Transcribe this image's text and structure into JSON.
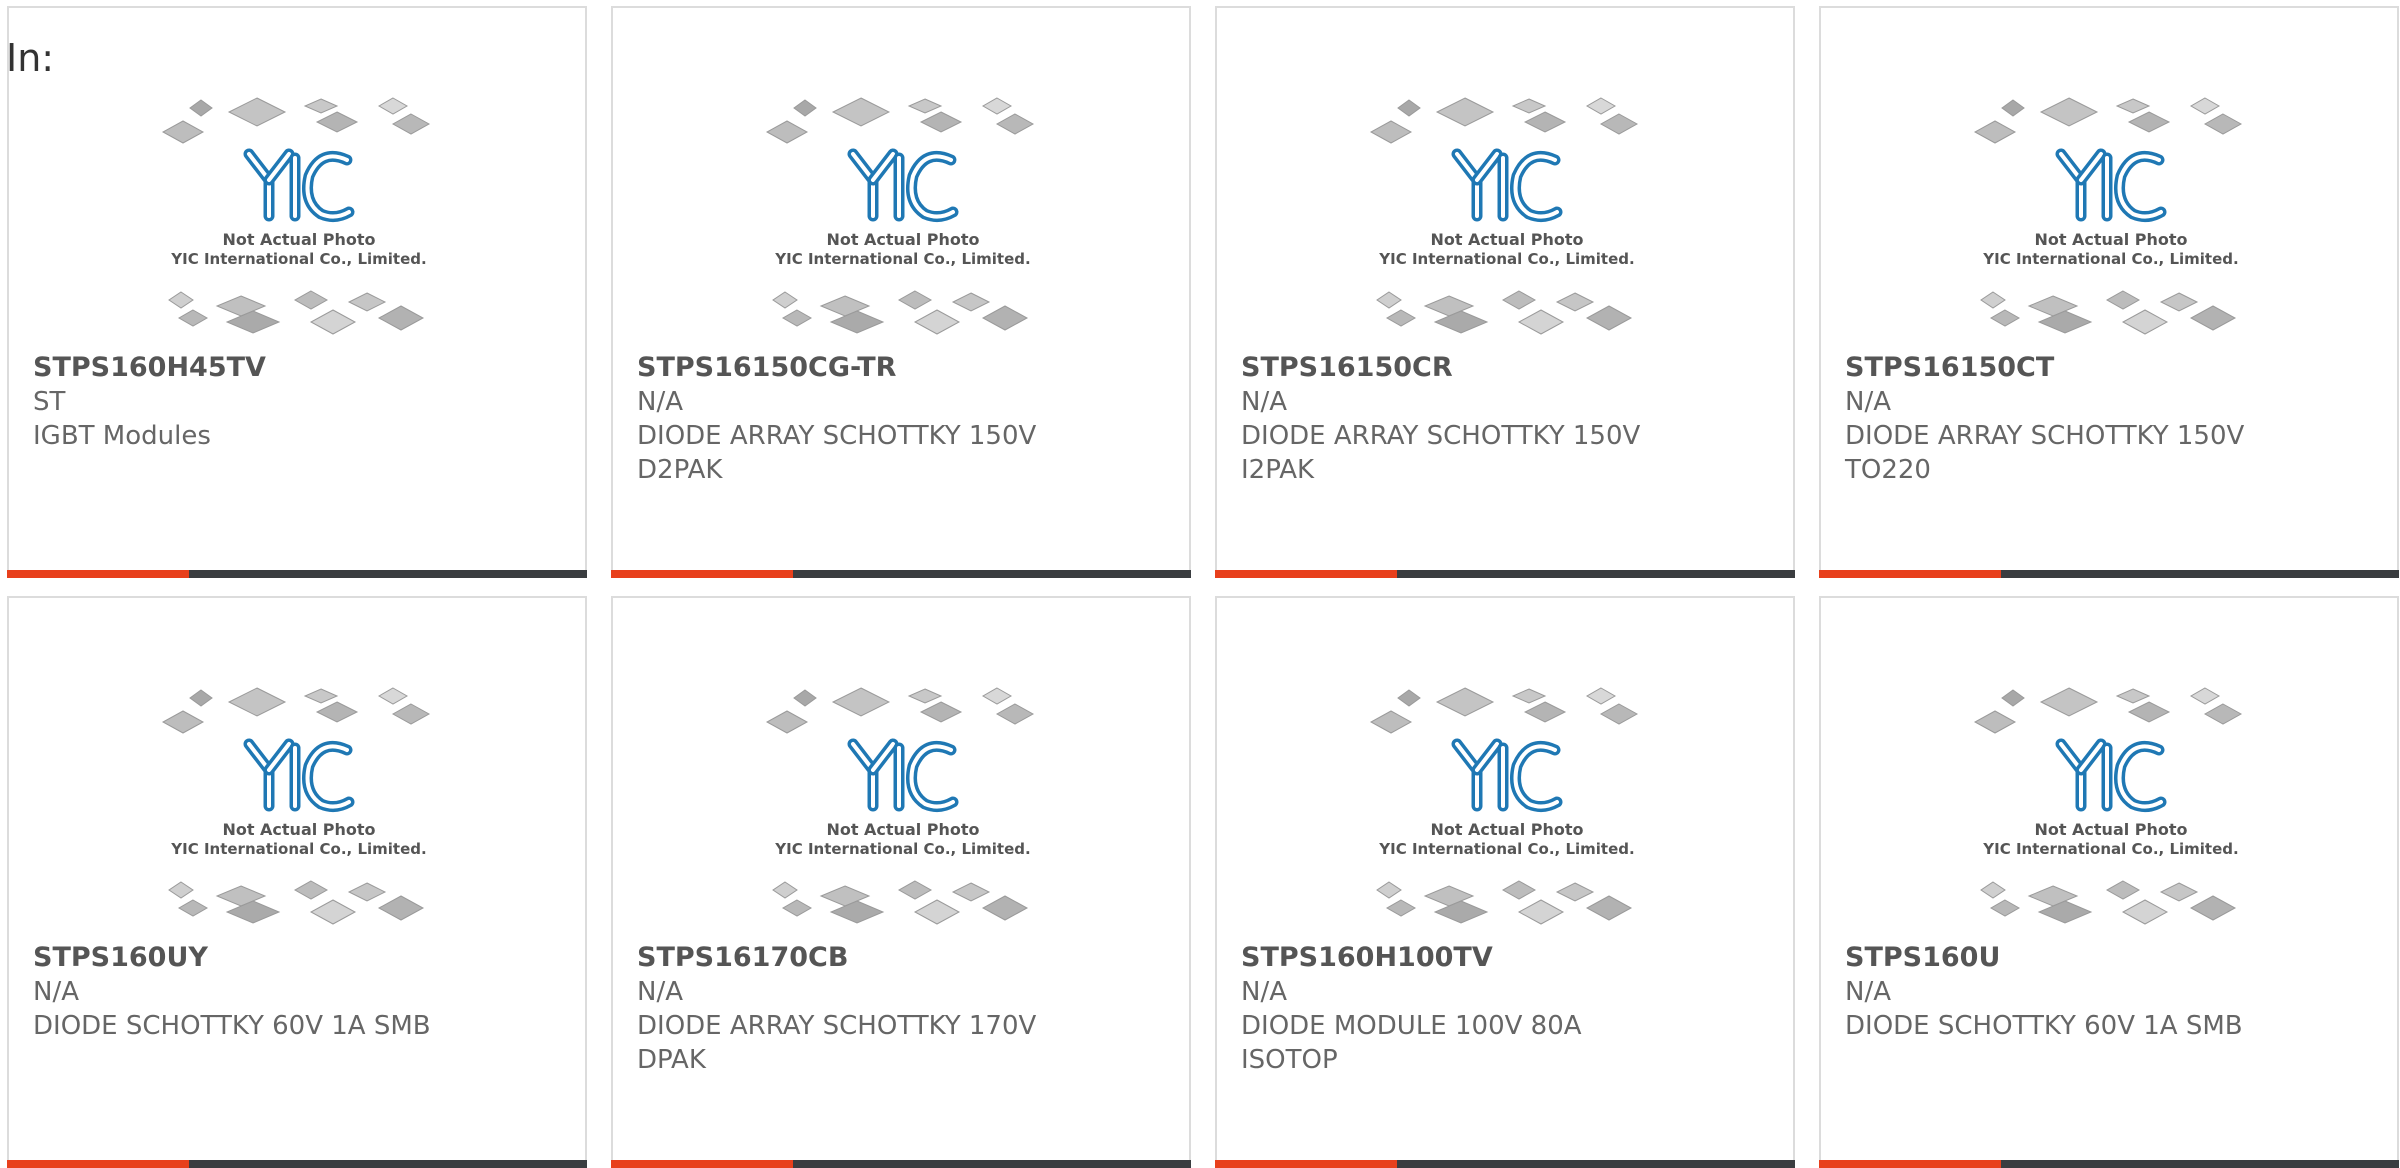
{
  "page": {
    "label": "In:"
  },
  "placeholder": {
    "line1": "Not Actual Photo",
    "line2": "YIC International Co., Limited.",
    "logo_text": "YIC"
  },
  "colors": {
    "accent": "#e8401c",
    "bar": "#3a3d40",
    "logo_blue": "#1f78b4",
    "card_border": "#dcdcdc",
    "text": "#666666"
  },
  "products": [
    {
      "part": "STPS160H45TV",
      "maker": "ST",
      "desc": "IGBT Modules"
    },
    {
      "part": "STPS16150CG-TR",
      "maker": "N/A",
      "desc": "DIODE ARRAY SCHOTTKY 150V\nD2PAK"
    },
    {
      "part": "STPS16150CR",
      "maker": "N/A",
      "desc": "DIODE ARRAY SCHOTTKY 150V\nI2PAK"
    },
    {
      "part": "STPS16150CT",
      "maker": "N/A",
      "desc": "DIODE ARRAY SCHOTTKY 150V\nTO220"
    },
    {
      "part": "STPS160UY",
      "maker": "N/A",
      "desc": "DIODE SCHOTTKY 60V 1A SMB"
    },
    {
      "part": "STPS16170CB",
      "maker": "N/A",
      "desc": "DIODE ARRAY SCHOTTKY 170V\nDPAK"
    },
    {
      "part": "STPS160H100TV",
      "maker": "N/A",
      "desc": "DIODE MODULE 100V 80A\nISOTOP"
    },
    {
      "part": "STPS160U",
      "maker": "N/A",
      "desc": "DIODE SCHOTTKY 60V 1A SMB"
    }
  ]
}
